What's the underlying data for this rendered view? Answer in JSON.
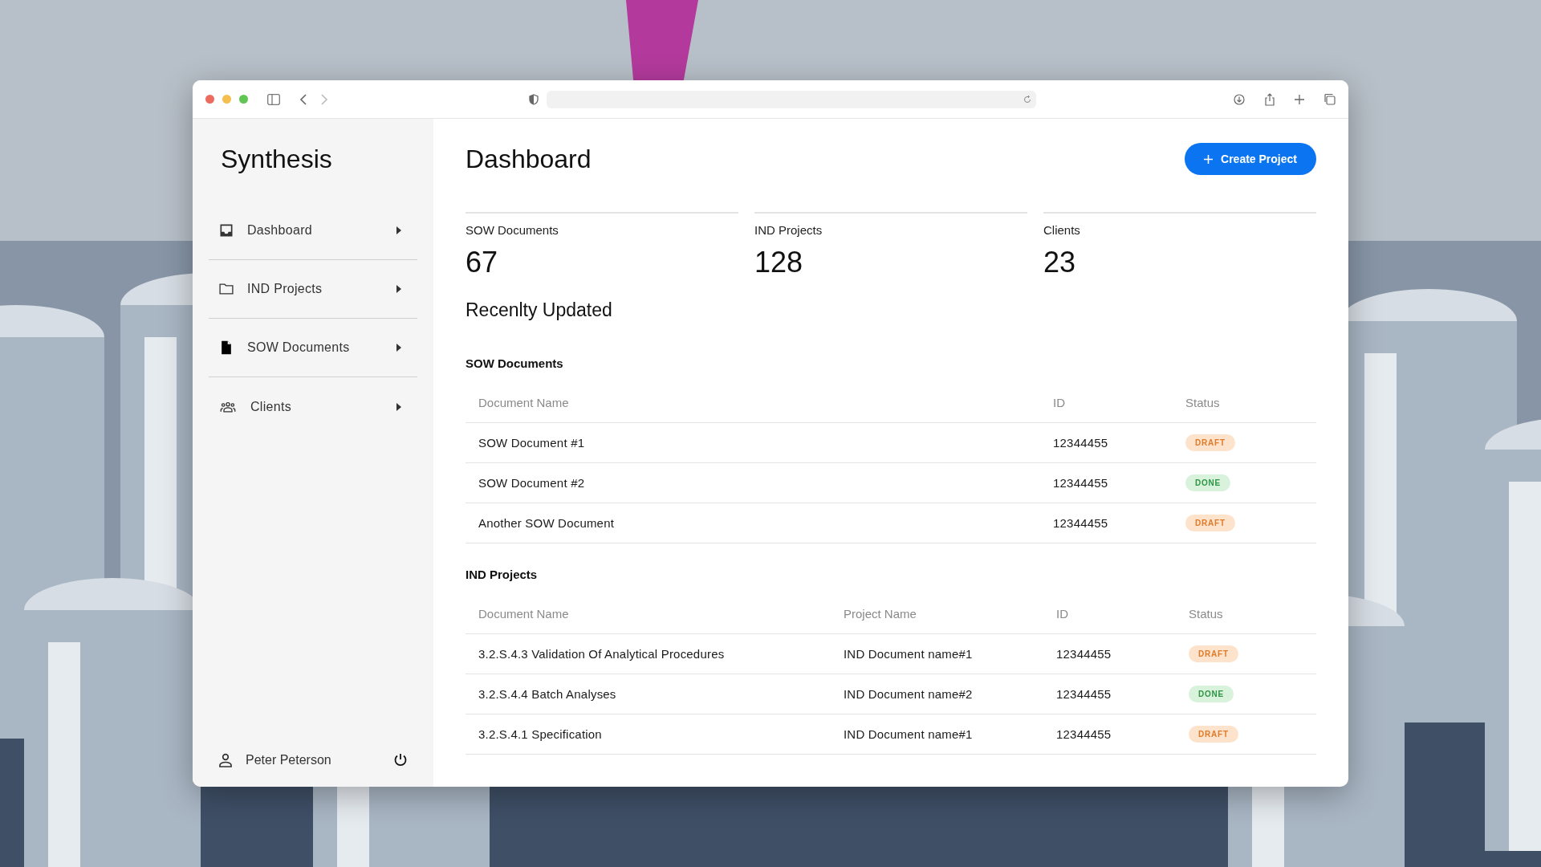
{
  "app": {
    "name": "Synthesis"
  },
  "sidebar": {
    "items": [
      {
        "label": "Dashboard",
        "kind": "inbox"
      },
      {
        "label": "IND Projects",
        "kind": "folder"
      },
      {
        "label": "SOW Documents",
        "kind": "file"
      },
      {
        "label": "Clients",
        "kind": "people"
      }
    ],
    "user": {
      "name": "Peter Peterson"
    }
  },
  "page": {
    "title": "Dashboard",
    "create_button": "Create Project"
  },
  "stats": [
    {
      "label": "SOW Documents",
      "value": "67"
    },
    {
      "label": "IND Projects",
      "value": "128"
    },
    {
      "label": "Clients",
      "value": "23"
    }
  ],
  "recent": {
    "title": "Recenlty Updated"
  },
  "tables": [
    {
      "title": "SOW Documents",
      "columns": [
        "Document Name",
        "ID",
        "Status"
      ],
      "rows": [
        {
          "cells": [
            "SOW Document #1",
            "12344455"
          ],
          "status": {
            "label": "DRAFT",
            "kind": "draft"
          }
        },
        {
          "cells": [
            "SOW Document #2",
            "12344455"
          ],
          "status": {
            "label": "DONE",
            "kind": "done"
          }
        },
        {
          "cells": [
            "Another SOW Document",
            "12344455"
          ],
          "status": {
            "label": "DRAFT",
            "kind": "draft"
          }
        }
      ]
    },
    {
      "title": "IND Projects",
      "columns": [
        "Document Name",
        "Project Name",
        "ID",
        "Status"
      ],
      "rows": [
        {
          "cells": [
            "3.2.S.4.3 Validation Of Analytical Procedures",
            "IND Document name#1",
            "12344455"
          ],
          "status": {
            "label": "DRAFT",
            "kind": "draft"
          }
        },
        {
          "cells": [
            "3.2.S.4.4 Batch Analyses",
            "IND Document name#2",
            "12344455"
          ],
          "status": {
            "label": "DONE",
            "kind": "done"
          }
        },
        {
          "cells": [
            "3.2.S.4.1 Specification",
            "IND Document name#1",
            "12344455"
          ],
          "status": {
            "label": "DRAFT",
            "kind": "draft"
          }
        }
      ]
    }
  ]
}
